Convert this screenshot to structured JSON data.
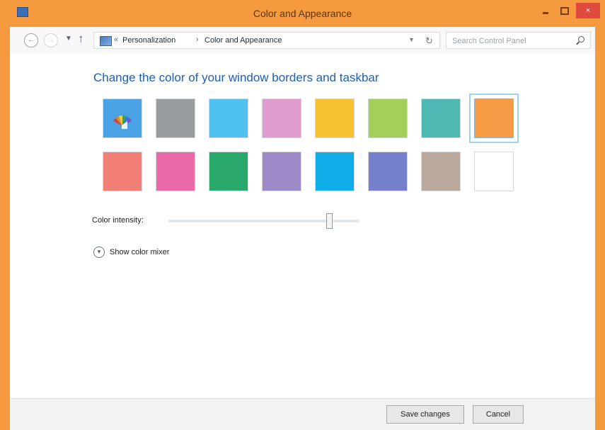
{
  "window": {
    "title": "Color and Appearance",
    "close_label": "×"
  },
  "address_bar": {
    "back_icon": "back-arrow-icon",
    "forward_icon": "forward-arrow-icon",
    "recent_icon": "chevron-down-icon",
    "up_icon": "up-arrow-icon",
    "location_icon": "control-panel-icon",
    "breadcrumbs": [
      "Personalization",
      "Color and Appearance"
    ],
    "search_placeholder": "Search Control Panel"
  },
  "main": {
    "heading": "Change the color of your window borders and taskbar",
    "swatches": [
      {
        "type": "automatic",
        "icon": "palette-icon",
        "color": "#4aa3e4"
      },
      {
        "color": "#999da0"
      },
      {
        "color": "#4fc2f0"
      },
      {
        "color": "#df9ccf"
      },
      {
        "color": "#f7c332"
      },
      {
        "color": "#a3d05a"
      },
      {
        "color": "#4db9b2"
      },
      {
        "color": "#f69a44",
        "selected": true
      },
      {
        "color": "#f17f76"
      },
      {
        "color": "#ea6aa8"
      },
      {
        "color": "#28a86a"
      },
      {
        "color": "#9c8bc8"
      },
      {
        "color": "#10aee8"
      },
      {
        "color": "#7480cc"
      },
      {
        "color": "#b9a89c"
      },
      {
        "color": "#ffffff"
      }
    ],
    "intensity_label": "Color intensity:",
    "intensity_level": 0.84,
    "mixer_label": "Show color mixer",
    "mixer_icon": "chevron-down-icon"
  },
  "footer": {
    "save_label": "Save changes",
    "cancel_label": "Cancel"
  },
  "colors": {
    "frame": "#f59a3e",
    "heading": "#1f5fb0"
  }
}
